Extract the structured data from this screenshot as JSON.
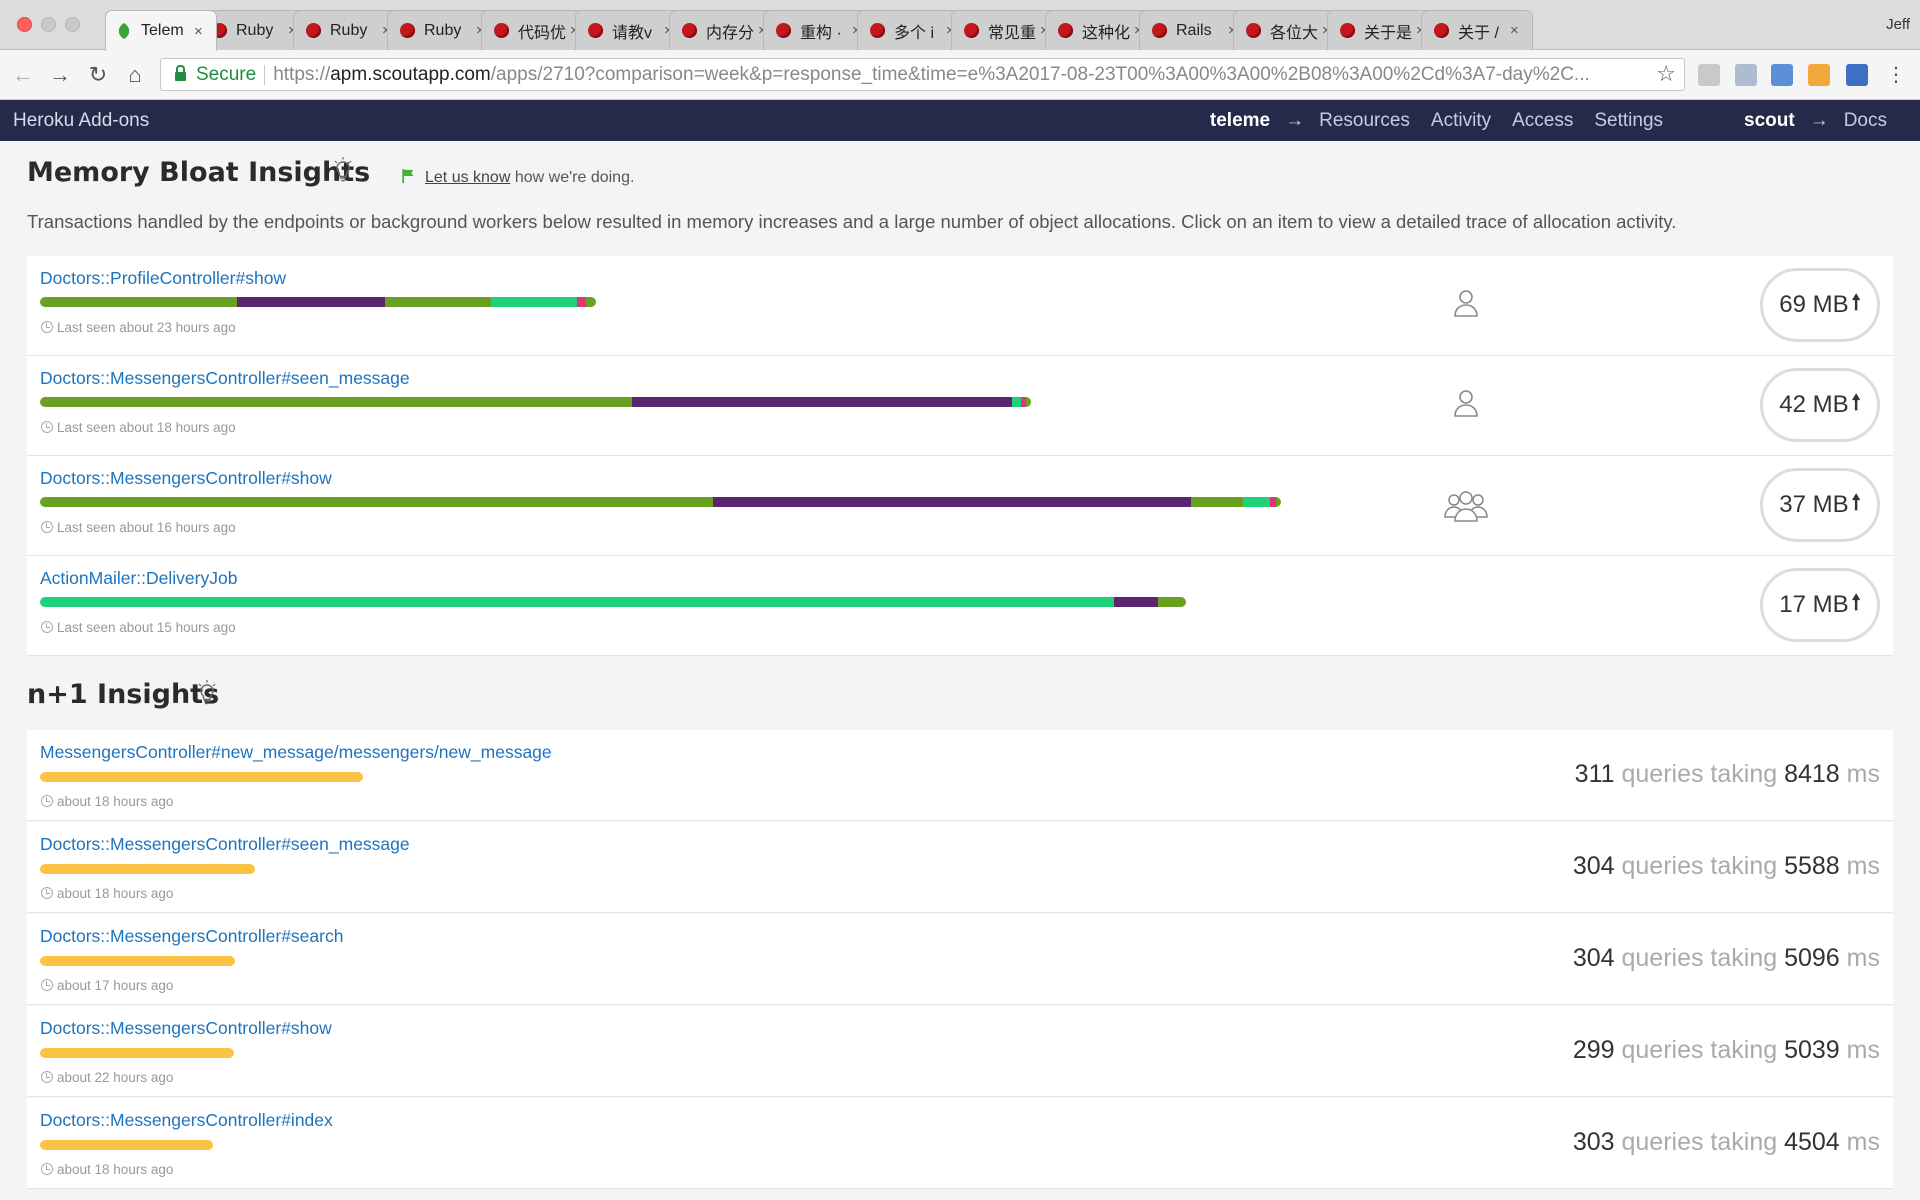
{
  "browser": {
    "tabs": [
      {
        "label": "Telem",
        "active": true
      },
      {
        "label": "Ruby"
      },
      {
        "label": "Ruby"
      },
      {
        "label": "Ruby"
      },
      {
        "label": "代码优"
      },
      {
        "label": "请教v"
      },
      {
        "label": "内存分"
      },
      {
        "label": "重构 ·"
      },
      {
        "label": "多个 i"
      },
      {
        "label": "常见重"
      },
      {
        "label": "这种化"
      },
      {
        "label": "Rails"
      },
      {
        "label": "各位大"
      },
      {
        "label": "关于是"
      },
      {
        "label": "关于 /"
      }
    ],
    "profile": "Jeff",
    "secure_label": "Secure",
    "url_scheme": "https://",
    "url_host": "apm.scoutapp.com",
    "url_path": "/apps/2710?comparison=week&p=response_time&time=e%3A2017-08-23T00%3A00%3A00%2B08%3A00%2Cd%3A7-day%2C..."
  },
  "heroku": {
    "brand": "Heroku Add-ons",
    "app": "teleme",
    "arrow": "→",
    "links": [
      "Resources",
      "Activity",
      "Access",
      "Settings"
    ],
    "addon": "scout",
    "docs": "Docs"
  },
  "memory": {
    "title": "Memory Bloat Insights",
    "feedback_link": "Let us know",
    "feedback_rest": " how we're doing.",
    "description": "Transactions handled by the endpoints or background workers below resulted in memory increases and a large number of object allocations. Click on an item to view a detailed trace of allocation activity.",
    "items": [
      {
        "name": "Doctors::ProfileController#show",
        "seen": "Last seen about 23 hours ago",
        "users": "single",
        "size": "69 MB",
        "bar_fraction": 0.445,
        "segments": [
          {
            "c": "#6aa121",
            "w": 35.5
          },
          {
            "c": "#5b2570",
            "w": 26.5
          },
          {
            "c": "#6aa121",
            "w": 19
          },
          {
            "c": "#1fd178",
            "w": 15.5
          },
          {
            "c": "#e0337a",
            "w": 1.6
          },
          {
            "c": "#6aa121",
            "w": 1.9
          }
        ]
      },
      {
        "name": "Doctors::MessengersController#seen_message",
        "seen": "Last seen about 18 hours ago",
        "users": "single",
        "size": "42 MB",
        "bar_fraction": 0.793,
        "segments": [
          {
            "c": "#6aa121",
            "w": 59.7
          },
          {
            "c": "#5b2570",
            "w": 38.4
          },
          {
            "c": "#1fd178",
            "w": 0.9
          },
          {
            "c": "#e0337a",
            "w": 0.5
          },
          {
            "c": "#6aa121",
            "w": 0.5
          }
        ]
      },
      {
        "name": "Doctors::MessengersController#show",
        "seen": "Last seen about 16 hours ago",
        "users": "group",
        "size": "37 MB",
        "bar_fraction": 0.993,
        "segments": [
          {
            "c": "#6aa121",
            "w": 54.2
          },
          {
            "c": "#5b2570",
            "w": 38.5
          },
          {
            "c": "#6aa121",
            "w": 4.2
          },
          {
            "c": "#1fd178",
            "w": 2.2
          },
          {
            "c": "#e0337a",
            "w": 0.5
          },
          {
            "c": "#6aa121",
            "w": 0.4
          }
        ]
      },
      {
        "name": "ActionMailer::DeliveryJob",
        "seen": "Last seen about 15 hours ago",
        "users": "",
        "size": "17 MB",
        "bar_fraction": 0.917,
        "segments": [
          {
            "c": "#1fd178",
            "w": 93.7
          },
          {
            "c": "#5b2570",
            "w": 3.8
          },
          {
            "c": "#6aa121",
            "w": 2.5
          }
        ]
      }
    ]
  },
  "nplus1": {
    "title": "n+1 Insights",
    "queries_word": "queries taking",
    "ms_word": "ms",
    "items": [
      {
        "name": "MessengersController#new_message",
        "path": "/messengers/new_message",
        "seen": "about 18 hours ago",
        "queries": "311",
        "time": "8418",
        "bar_fraction": 0.258
      },
      {
        "name": "Doctors::MessengersController#seen_message",
        "path": "",
        "seen": "about 18 hours ago",
        "queries": "304",
        "time": "5588",
        "bar_fraction": 0.172
      },
      {
        "name": "Doctors::MessengersController#search",
        "path": "",
        "seen": "about 17 hours ago",
        "queries": "304",
        "time": "5096",
        "bar_fraction": 0.156
      },
      {
        "name": "Doctors::MessengersController#show",
        "path": "",
        "seen": "about 22 hours ago",
        "queries": "299",
        "time": "5039",
        "bar_fraction": 0.155
      },
      {
        "name": "Doctors::MessengersController#index",
        "path": "",
        "seen": "about 18 hours ago",
        "queries": "303",
        "time": "4504",
        "bar_fraction": 0.138
      }
    ]
  }
}
